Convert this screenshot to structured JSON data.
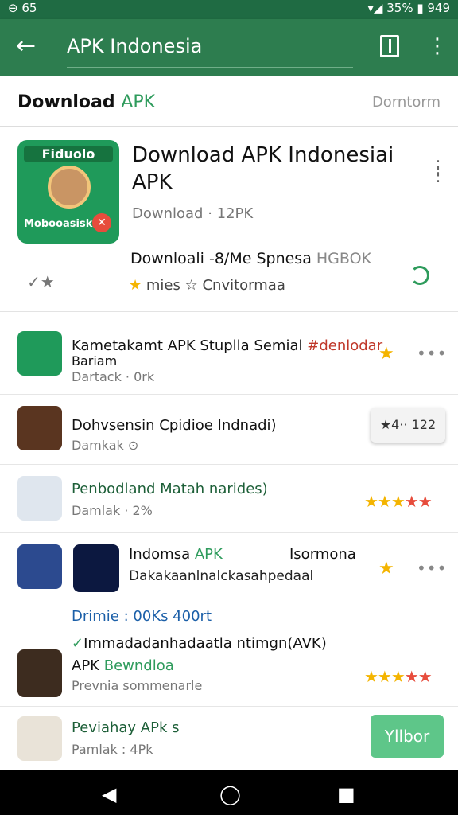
{
  "status": {
    "left": "⊖ 65",
    "right": "▾◢ 35% ▮ 949"
  },
  "appbar": {
    "back": "←",
    "title": "APK Indonesia",
    "more": "⋮"
  },
  "tabs": {
    "primary_a": "Download",
    "primary_b": "APK",
    "secondary": "Dorntorm"
  },
  "hero": {
    "icon_top": "Fiduolo",
    "icon_bottom": "Mobooasisk",
    "icon_badge": "✕",
    "title": "Download APK Indonesiai APK",
    "meta": "Download · 12PK",
    "sub_main": "Downloali -8/Me Spnesa",
    "sub_grey": "HGBOK",
    "left_icon": "✓★",
    "stars_a": "mies",
    "stars_b": "Cnvitormaa"
  },
  "items": [
    {
      "name": "Kametakamt APK Stuplla Semial",
      "tag": "#denlodar",
      "name2": "Bariam",
      "sub": "Dartack · 0rk"
    },
    {
      "name": "Dohvsensin Cpidioe Indnadi)",
      "sub": "Damkak",
      "chip": "★4·· 122"
    },
    {
      "name": "Penbodland Matah narides)",
      "sub": "Damlak · 2%"
    },
    {
      "name_a": "Indomsa",
      "name_b": "APK",
      "name_c": "Isormona",
      "sub": "Dakakaanlnalckasahpedaal"
    },
    {
      "line1": "Drimie : 00Ks 400rt",
      "line2": "Immadadanhadaatla ntimgn(AVK)",
      "name_a": "APK",
      "name_b": "Bewndloa",
      "sub": "Prevnia sommenarle"
    },
    {
      "name": "Peviahay APk s",
      "sub": "Pamlak : 4Pk",
      "button": "Yllbor"
    }
  ],
  "colors": {
    "appbar": "#2d7d4f",
    "status": "#1f6b43",
    "accent": "#2e9b5c",
    "button": "#5ec689"
  }
}
